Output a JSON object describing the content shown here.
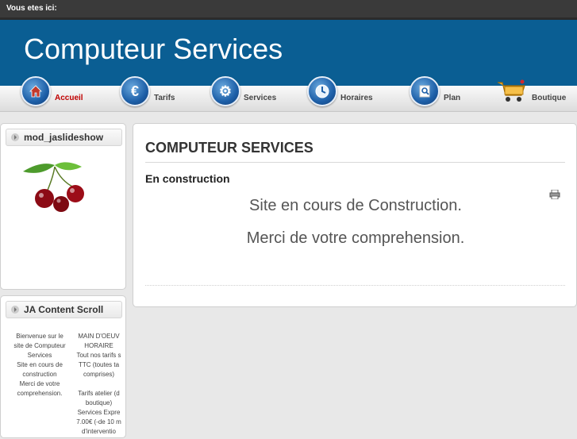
{
  "topbar": {
    "breadcrumb_label": "Vous etes ici:"
  },
  "header": {
    "site_title": "Computeur Services",
    "bg_color": "#0a5e93"
  },
  "nav": {
    "items": [
      {
        "label": "Accueil",
        "icon": "home-icon",
        "active": true
      },
      {
        "label": "Tarifs",
        "icon": "euro-icon",
        "active": false
      },
      {
        "label": "Services",
        "icon": "gears-icon",
        "active": false
      },
      {
        "label": "Horaires",
        "icon": "clock-icon",
        "active": false
      },
      {
        "label": "Plan",
        "icon": "map-search-icon",
        "active": false
      },
      {
        "label": "Boutique",
        "icon": "cart-icon",
        "active": false
      }
    ]
  },
  "sidebar": {
    "slideshow": {
      "title": "mod_jaslideshow",
      "image": "cherries-image"
    },
    "content_scroll": {
      "title": "JA Content Scroll",
      "col1": "Bienvenue sur le\nsite de Computeur\nServices\nSite en cours de\nconstruction\nMerci de votre\ncomprehension.",
      "col2": "MAIN D'OEUV\nHORAIRE\nTout nos tarifs s\nTTC (toutes ta\ncomprises)\n\nTarifs atelier (d\nboutique)\nServices Expre\n7.00€ (-de 10 m\nd'interventio"
    }
  },
  "main": {
    "title": "COMPUTEUR SERVICES",
    "subtitle": "En construction",
    "line1": "Site en cours de Construction.",
    "line2": "Merci de votre comprehension.",
    "print_icon": "print-icon"
  }
}
